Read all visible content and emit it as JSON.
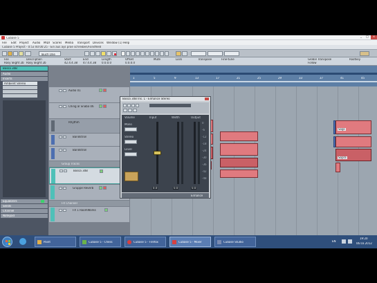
{
  "window": {
    "title": "Cubase 5",
    "controls": [
      "_",
      "□",
      "x"
    ]
  },
  "menu": {
    "items": [
      "File",
      "Edit",
      "Project",
      "Audio",
      "MIDI",
      "Scores",
      "Media",
      "Transport",
      "Devices",
      "Window (1)",
      "Help"
    ]
  },
  "project": {
    "title": "Cubase 5 Project - 0:53 00:00:25 - Ein aus ays proe schreiben/Fondfield"
  },
  "toolbar": {
    "mode_select": "Touch One"
  },
  "infoline": {
    "headers": [
      "File",
      "Description",
      "Start",
      "End",
      "Length",
      "Offset",
      "Mute",
      "Lock",
      "Transpose",
      "Fine-tune",
      "Global Transpose",
      "Rootkey"
    ],
    "values": [
      "Rosy Slight 2b",
      "Rosy Slight 2b",
      "42.4.4.38",
      "47.4.4.38",
      "0.0.0.0",
      "0.0.0.0",
      "",
      "",
      "",
      "",
      "Follow",
      ""
    ]
  },
  "inspector": {
    "header": "Bossa 30B",
    "fields": [
      "Audio",
      "Inserts",
      "Ambient Stereo"
    ],
    "bottom_items": [
      "Equalizers",
      "Sends",
      "Channel",
      "Notepad"
    ]
  },
  "tracks": [
    {
      "name": "Audio 01",
      "kind": "audio"
    },
    {
      "name": "Ching al Snaba 06",
      "kind": "audio"
    },
    {
      "name": "Rhythm",
      "kind": "group"
    },
    {
      "name": "Bandstron",
      "kind": "audio"
    },
    {
      "name": "Bandstron",
      "kind": "audio"
    },
    {
      "name": "Group Tracks",
      "kind": "folder"
    },
    {
      "name": "Bossa 30B",
      "kind": "selected"
    },
    {
      "name": "Gruppe Reverb",
      "kind": "fx"
    },
    {
      "name": "FX Channel",
      "kind": "folder"
    },
    {
      "name": "FX 1 RoomWorks",
      "kind": "fx"
    }
  ],
  "ruler": {
    "bars": [
      "1",
      "5",
      "9",
      "13",
      "17",
      "21",
      "25",
      "29",
      "33",
      "37",
      "41",
      "45"
    ]
  },
  "segments": {
    "left_labels": [
      "",
      "",
      "",
      ""
    ],
    "right_labels": [
      "Sogs",
      "",
      "Sopra",
      ""
    ]
  },
  "plugin": {
    "title": "Bossa 30B Ins. 1 - Enhance Stereo",
    "controls_label": "Volume",
    "sections": [
      "Input",
      "Width",
      "Output"
    ],
    "left_labels": [
      "Mono",
      "Stereo",
      "Level"
    ],
    "readouts": [
      "0.0",
      "0.0",
      "0.0"
    ],
    "scale": [
      "0",
      "-6",
      "-12",
      "-18",
      "-24",
      "-30",
      "-36",
      "-42",
      "-48"
    ],
    "footer": "Enhance"
  },
  "taskbar": {
    "tasks": [
      "Paint",
      "Cubase 5 - Chess",
      "Cubase 5 - Firefox",
      "Cubase 5 - Mixer",
      "Cubase Studio"
    ],
    "lang": "EN",
    "time": "19:20",
    "date": "06.03.2012"
  },
  "colors": {
    "desktop": "#000000",
    "ruler": "#5d7fa6",
    "segment": "#e07a7f",
    "selected_track": "#4fc0b8",
    "taskbar": "#2f4f7c"
  }
}
